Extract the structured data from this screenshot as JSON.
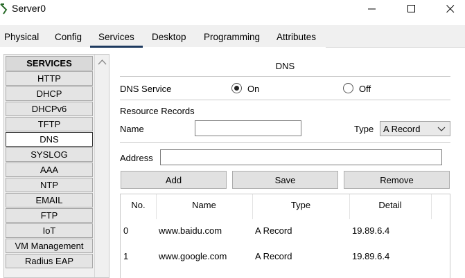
{
  "window": {
    "title": "Server0",
    "minimize_icon": "minimize-icon",
    "maximize_icon": "maximize-icon",
    "close_icon": "close-icon"
  },
  "tabs": [
    {
      "label": "Physical"
    },
    {
      "label": "Config"
    },
    {
      "label": "Services",
      "active": true
    },
    {
      "label": "Desktop"
    },
    {
      "label": "Programming"
    },
    {
      "label": "Attributes"
    }
  ],
  "sidebar": {
    "header": "SERVICES",
    "items": [
      {
        "label": "HTTP"
      },
      {
        "label": "DHCP"
      },
      {
        "label": "DHCPv6"
      },
      {
        "label": "TFTP"
      },
      {
        "label": "DNS",
        "selected": true
      },
      {
        "label": "SYSLOG"
      },
      {
        "label": "AAA"
      },
      {
        "label": "NTP"
      },
      {
        "label": "EMAIL"
      },
      {
        "label": "FTP"
      },
      {
        "label": "IoT"
      },
      {
        "label": "VM Management"
      },
      {
        "label": "Radius EAP"
      }
    ]
  },
  "dns": {
    "title": "DNS",
    "service_label": "DNS Service",
    "on_label": "On",
    "off_label": "Off",
    "service_state": "On",
    "resource_records_label": "Resource Records",
    "name_label": "Name",
    "name_value": "",
    "type_label": "Type",
    "type_value": "A Record",
    "address_label": "Address",
    "address_value": "",
    "add_label": "Add",
    "save_label": "Save",
    "remove_label": "Remove"
  },
  "table": {
    "columns": [
      "No.",
      "Name",
      "Type",
      "Detail"
    ],
    "rows": [
      {
        "no": "0",
        "name": "www.baidu.com",
        "type": "A Record",
        "detail": "19.89.6.4"
      },
      {
        "no": "1",
        "name": "www.google.com",
        "type": "A Record",
        "detail": "19.89.6.4"
      }
    ]
  },
  "colors": {
    "active_tab_underline": "#1e3a5f",
    "panel_bg": "#f0f0f0",
    "button_bg": "#e1e1e1"
  }
}
